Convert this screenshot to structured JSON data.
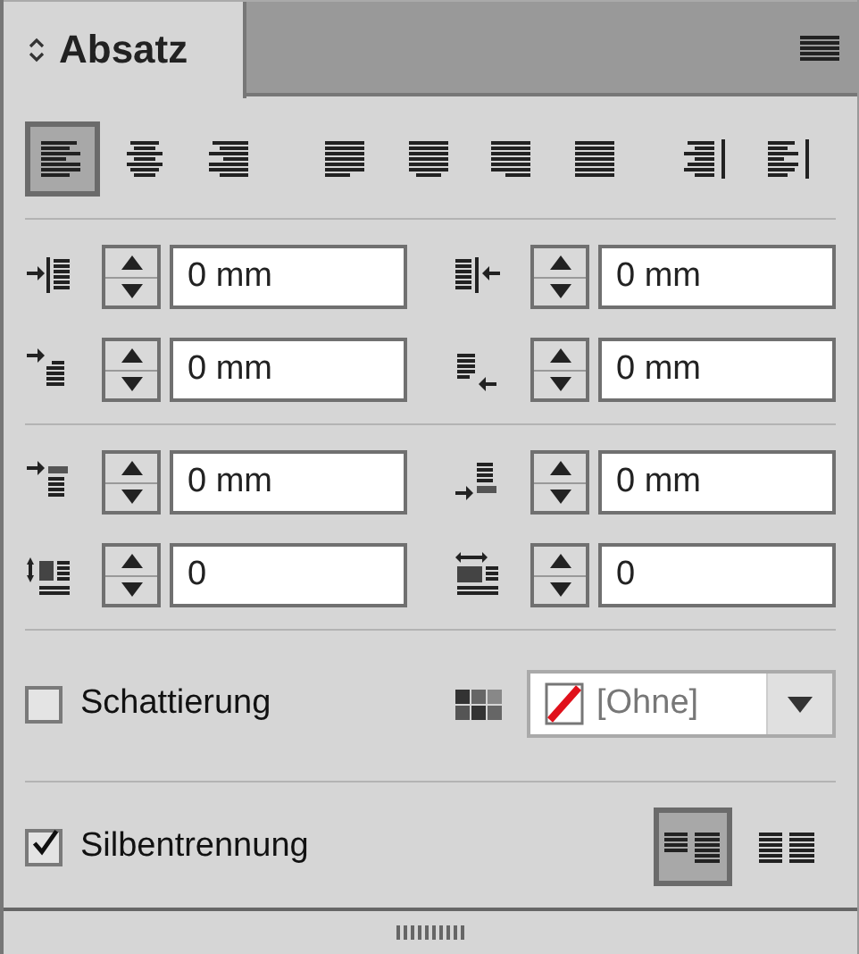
{
  "panel": {
    "title": "Absatz"
  },
  "alignment_buttons": [
    {
      "kind": "left",
      "selected": true
    },
    {
      "kind": "center",
      "selected": false
    },
    {
      "kind": "right",
      "selected": false
    },
    {
      "kind": "justify-left",
      "selected": false
    },
    {
      "kind": "justify-center",
      "selected": false
    },
    {
      "kind": "justify-right",
      "selected": false
    },
    {
      "kind": "justify-all",
      "selected": false
    },
    {
      "kind": "toward-spine",
      "selected": false
    },
    {
      "kind": "away-from-spine",
      "selected": false
    }
  ],
  "field_groups": [
    [
      {
        "kind": "left-indent",
        "value": "0 mm"
      },
      {
        "kind": "right-indent",
        "value": "0 mm"
      },
      {
        "kind": "first-line-indent",
        "value": "0 mm"
      },
      {
        "kind": "last-line-indent",
        "value": "0 mm"
      }
    ],
    [
      {
        "kind": "space-before",
        "value": "0 mm"
      },
      {
        "kind": "space-after",
        "value": "0 mm"
      },
      {
        "kind": "drop-cap-lines",
        "value": "0"
      },
      {
        "kind": "drop-cap-chars",
        "value": "0"
      }
    ]
  ],
  "shading": {
    "label": "Schattierung",
    "checked": false,
    "swatch": "[Ohne]"
  },
  "hyphenation": {
    "label": "Silbentrennung",
    "checked": true
  },
  "composer_buttons": [
    {
      "kind": "single-line",
      "selected": true
    },
    {
      "kind": "multi-line",
      "selected": false
    }
  ]
}
